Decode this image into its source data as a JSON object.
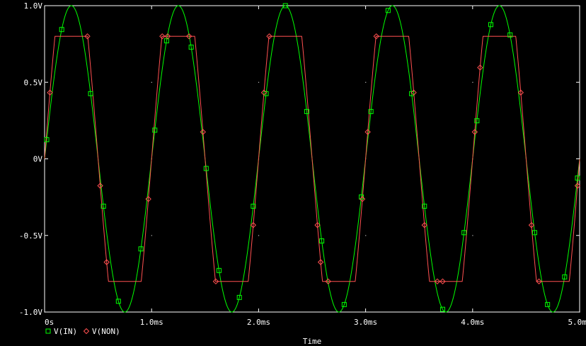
{
  "chart_data": {
    "type": "line",
    "xlabel": "Time",
    "ylabel": "",
    "xlim": [
      0,
      5.0
    ],
    "ylim": [
      -1.0,
      1.0
    ],
    "x_unit": "ms",
    "x_ticks": [
      {
        "value": 0,
        "label": "0s"
      },
      {
        "value": 1,
        "label": "1.0ms"
      },
      {
        "value": 2,
        "label": "2.0ms"
      },
      {
        "value": 3,
        "label": "3.0ms"
      },
      {
        "value": 4,
        "label": "4.0ms"
      },
      {
        "value": 5,
        "label": "5.0ms"
      }
    ],
    "y_ticks": [
      {
        "value": 1.0,
        "label": "1.0V"
      },
      {
        "value": 0.5,
        "label": "0.5V"
      },
      {
        "value": 0.0,
        "label": "0V"
      },
      {
        "value": -0.5,
        "label": "-0.5V"
      },
      {
        "value": -1.0,
        "label": "-1.0V"
      }
    ],
    "grid": "dotted",
    "legend_position": "bottom-left",
    "series": [
      {
        "name": "V(IN)",
        "color": "#00ff00",
        "marker": "square",
        "shape": "sine",
        "amplitude": 1.0,
        "frequency_khz": 1.0,
        "marker_x": [
          0.02,
          0.16,
          0.43,
          0.55,
          0.69,
          0.9,
          1.03,
          1.14,
          1.37,
          1.51,
          1.63,
          1.82,
          1.95,
          2.07,
          2.25,
          2.45,
          2.59,
          2.8,
          2.96,
          3.05,
          3.21,
          3.43,
          3.55,
          3.72,
          3.92,
          4.04,
          4.17,
          4.35,
          4.58,
          4.7,
          4.86,
          4.98
        ]
      },
      {
        "name": "V(NON)",
        "color": "#ff5050",
        "marker": "diamond",
        "shape": "clipped-sine",
        "clip_level": 0.8,
        "frequency_khz": 1.0,
        "marker_x": [
          0.05,
          0.4,
          0.52,
          0.58,
          0.97,
          1.1,
          1.15,
          1.35,
          1.48,
          1.6,
          1.95,
          2.05,
          2.1,
          2.55,
          2.58,
          2.65,
          2.97,
          3.02,
          3.1,
          3.45,
          3.55,
          3.67,
          3.72,
          4.02,
          4.07,
          4.45,
          4.55,
          4.62,
          4.98
        ]
      }
    ]
  }
}
